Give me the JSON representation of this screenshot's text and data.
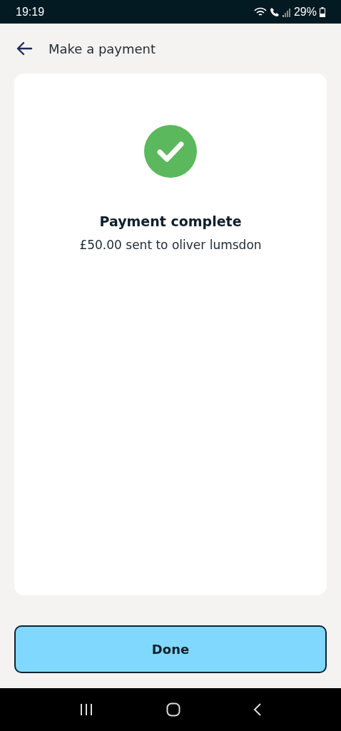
{
  "status_bar": {
    "time": "19:19",
    "battery": "29%"
  },
  "header": {
    "title": "Make a payment"
  },
  "result": {
    "title": "Payment complete",
    "message": "£50.00 sent to oliver lumsdon"
  },
  "buttons": [
    "Done"
  ]
}
